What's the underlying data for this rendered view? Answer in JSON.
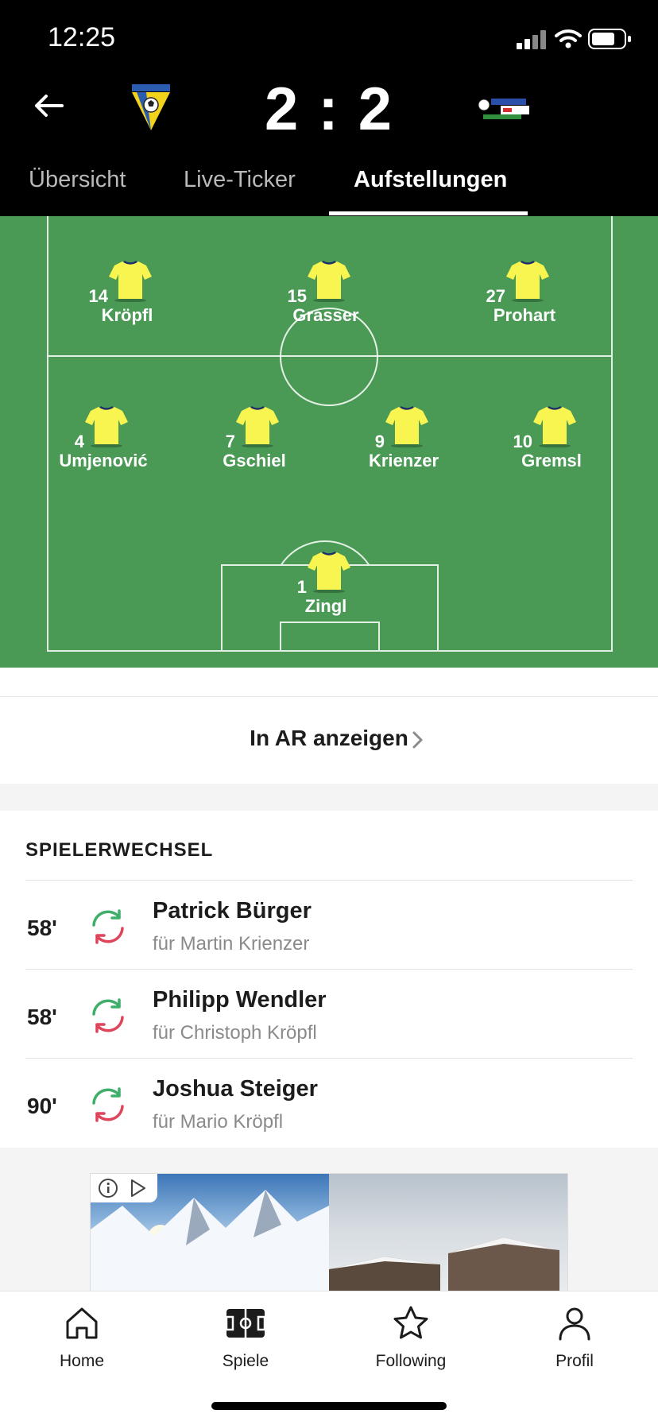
{
  "status_bar": {
    "time": "12:25"
  },
  "match": {
    "score": "2 : 2"
  },
  "tabs": [
    {
      "label": "Übersicht"
    },
    {
      "label": "Live-Ticker"
    },
    {
      "label": "Aufstellungen"
    }
  ],
  "lineup": {
    "shirt_color": "#f8f550",
    "players": [
      {
        "number": "14",
        "name": "Kröpfl"
      },
      {
        "number": "15",
        "name": "Grasser"
      },
      {
        "number": "27",
        "name": "Prohart"
      },
      {
        "number": "4",
        "name": "Umjenović"
      },
      {
        "number": "7",
        "name": "Gschiel"
      },
      {
        "number": "9",
        "name": "Krienzer"
      },
      {
        "number": "10",
        "name": "Gremsl"
      },
      {
        "number": "1",
        "name": "Zingl"
      }
    ]
  },
  "ar": {
    "label": "In AR anzeigen"
  },
  "substitutions": {
    "title": "SPIELERWECHSEL",
    "items": [
      {
        "minute": "58'",
        "player_in": "Patrick Bürger",
        "player_out": "für Martin Krienzer"
      },
      {
        "minute": "58'",
        "player_in": "Philipp Wendler",
        "player_out": "für Christoph Kröpfl"
      },
      {
        "minute": "90'",
        "player_in": "Joshua Steiger",
        "player_out": "für Mario Kröpfl"
      }
    ]
  },
  "nav": [
    {
      "label": "Home",
      "icon": "home-icon"
    },
    {
      "label": "Spiele",
      "icon": "pitch-icon"
    },
    {
      "label": "Following",
      "icon": "star-icon"
    },
    {
      "label": "Profil",
      "icon": "person-icon"
    }
  ],
  "colors": {
    "pitch": "#4a9a55",
    "sub_in": "#3fae6a",
    "sub_out": "#e0445a"
  }
}
